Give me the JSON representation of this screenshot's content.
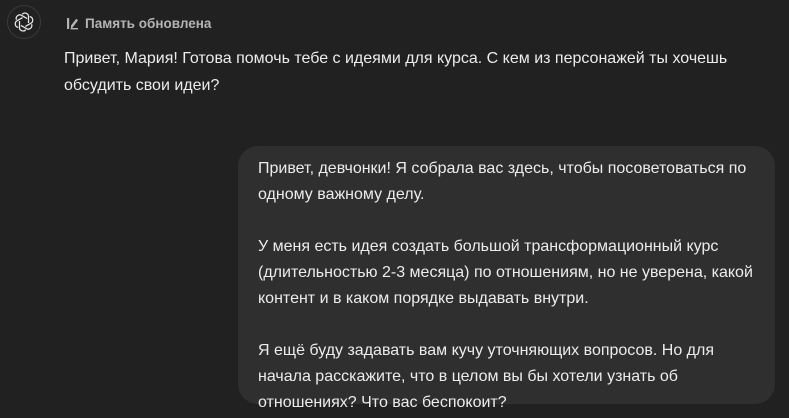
{
  "assistant": {
    "avatar_icon": "openai-logo-icon",
    "memory_icon": "memory-updated-icon",
    "memory_status": "Память обновлена",
    "message": "Привет, Мария! Готова помочь тебе с идеями для курса. С кем из персонажей ты хочешь обсудить свои идеи?"
  },
  "user": {
    "paragraphs": [
      "Привет, девчонки! Я собрала вас здесь, чтобы посоветоваться по одному важному делу.",
      "У меня есть идея создать большой трансформационный курс (длительностью 2-3 месяца) по отношениям, но не уверена, какой контент и в каком порядке выдавать внутри.",
      "Я ещё буду задавать вам кучу уточняющих вопросов. Но для начала расскажите, что в целом вы бы хотели узнать об отношениях? Что вас беспокоит?"
    ]
  },
  "colors": {
    "background": "#212121",
    "bubble": "#2f2f2f",
    "text": "#ececec",
    "muted": "#b4b4b4"
  }
}
